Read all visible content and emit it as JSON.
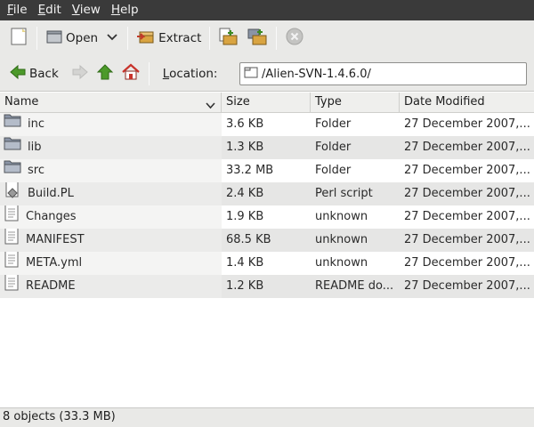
{
  "menubar": {
    "items": [
      {
        "mnemonic": "F",
        "rest": "ile"
      },
      {
        "mnemonic": "E",
        "rest": "dit"
      },
      {
        "mnemonic": "V",
        "rest": "iew"
      },
      {
        "mnemonic": "H",
        "rest": "elp"
      }
    ]
  },
  "toolbar": {
    "new_icon": "new-archive-icon",
    "open_label": "Open",
    "extract_label": "Extract",
    "add_files_icon": "add-files-icon",
    "add_folder_icon": "add-folder-icon",
    "stop_icon": "stop-icon"
  },
  "navbar": {
    "back_label": "Back",
    "location_label": "Location:",
    "location_mnemonic": "L",
    "location_rest": "ocation:",
    "location_value": "/Alien-SVN-1.4.6.0/"
  },
  "columns": {
    "name": "Name",
    "size": "Size",
    "type": "Type",
    "date": "Date Modified"
  },
  "rows": [
    {
      "name": "inc",
      "size": "3.6 KB",
      "type": "Folder",
      "date": "27 December 2007,...",
      "icon": "folder-icon"
    },
    {
      "name": "lib",
      "size": "1.3 KB",
      "type": "Folder",
      "date": "27 December 2007,...",
      "icon": "folder-icon"
    },
    {
      "name": "src",
      "size": "33.2 MB",
      "type": "Folder",
      "date": "27 December 2007,...",
      "icon": "folder-icon"
    },
    {
      "name": "Build.PL",
      "size": "2.4 KB",
      "type": "Perl script",
      "date": "27 December 2007,...",
      "icon": "script-icon"
    },
    {
      "name": "Changes",
      "size": "1.9 KB",
      "type": "unknown",
      "date": "27 December 2007,...",
      "icon": "text-file-icon"
    },
    {
      "name": "MANIFEST",
      "size": "68.5 KB",
      "type": "unknown",
      "date": "27 December 2007,...",
      "icon": "text-file-icon"
    },
    {
      "name": "META.yml",
      "size": "1.4 KB",
      "type": "unknown",
      "date": "27 December 2007,...",
      "icon": "text-file-icon"
    },
    {
      "name": "README",
      "size": "1.2 KB",
      "type": "README do...",
      "date": "27 December 2007,...",
      "icon": "text-file-icon"
    }
  ],
  "status": {
    "text": "8 objects (33.3 MB)"
  },
  "colors": {
    "menubar_bg": "#3a3a3a",
    "toolbar_bg": "#e9e9e7",
    "row_alt": "#ebebea",
    "row_sorted_col": "#f4f4f3",
    "folder": "#8a94a6",
    "arrow_green": "#4c9a2a",
    "home_red": "#c8332b"
  }
}
